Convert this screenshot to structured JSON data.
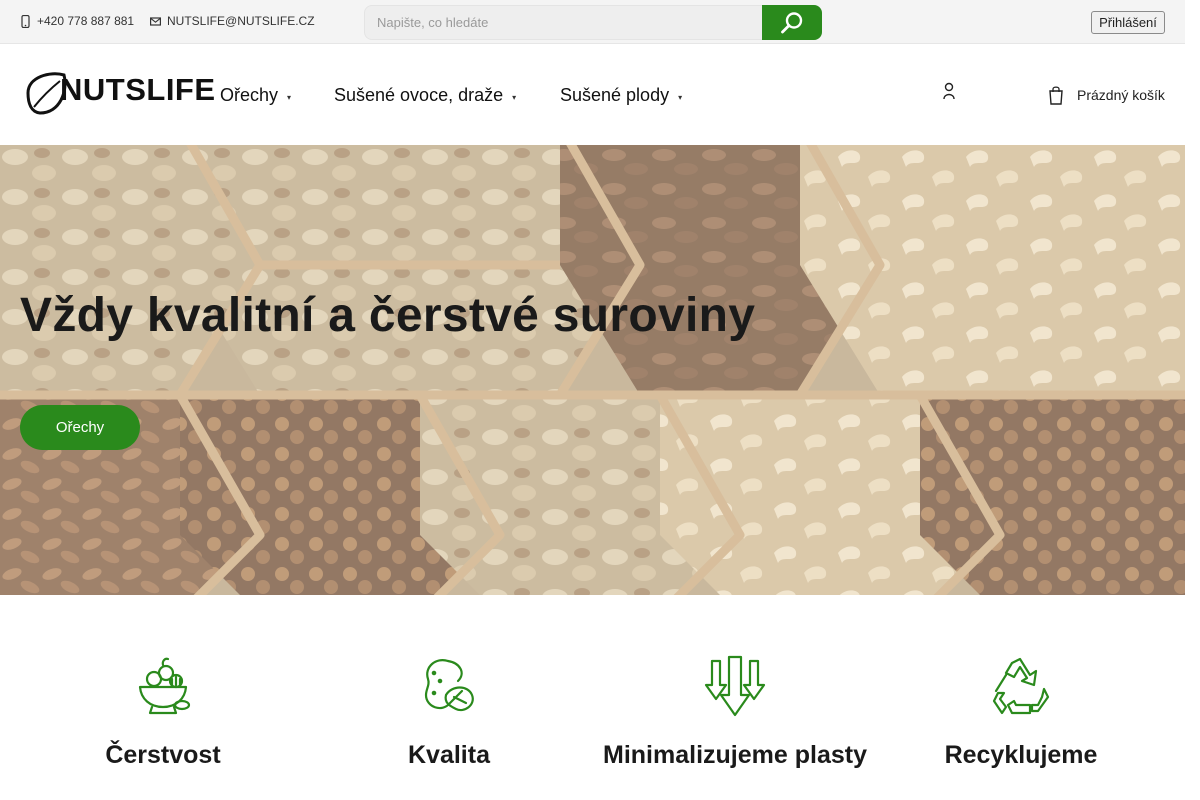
{
  "topbar": {
    "phone": "+420 778 887 881",
    "email": "NUTSLIFE@NUTSLIFE.CZ",
    "search_placeholder": "Napište, co hledáte",
    "login_label": "Přihlášení"
  },
  "header": {
    "logo_text": "NUTSLIFE",
    "nav": [
      {
        "label": "Ořechy"
      },
      {
        "label": "Sušené ovoce, draže"
      },
      {
        "label": "Sušené plody"
      }
    ],
    "cart_label": "Prázdný košík"
  },
  "hero": {
    "title": "Vždy kvalitní a čerstvé suroviny",
    "cta_label": "Ořechy"
  },
  "features": [
    {
      "title": "Čerstvost",
      "icon": "bowl-icon"
    },
    {
      "title": "Kvalita",
      "icon": "peanut-icon"
    },
    {
      "title": "Minimalizujeme plasty",
      "icon": "arrows-down-icon"
    },
    {
      "title": "Recyklujeme",
      "icon": "recycle-icon"
    }
  ],
  "colors": {
    "accent": "#2a8a1c",
    "topbar_bg": "#f4f4f4"
  }
}
